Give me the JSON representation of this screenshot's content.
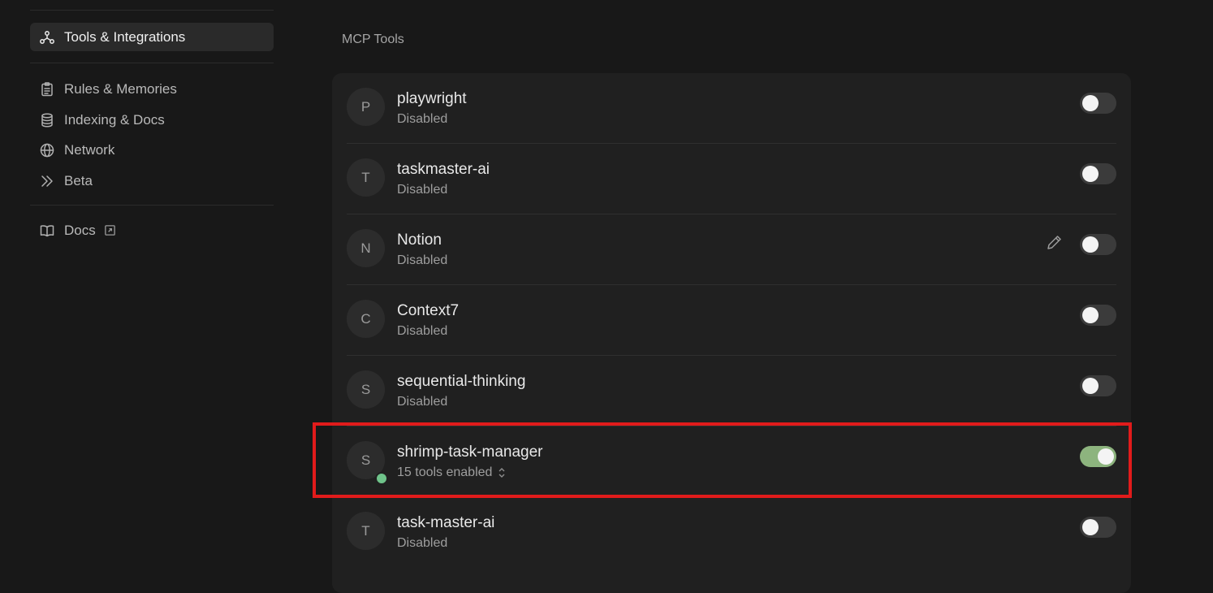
{
  "sidebar": {
    "items": [
      {
        "label": "Tools & Integrations",
        "icon": "tools-integrations-icon"
      },
      {
        "label": "Rules & Memories",
        "icon": "clipboard-icon"
      },
      {
        "label": "Indexing & Docs",
        "icon": "database-icon"
      },
      {
        "label": "Network",
        "icon": "globe-icon"
      },
      {
        "label": "Beta",
        "icon": "double-chevron-right-icon"
      },
      {
        "label": "Docs",
        "icon": "book-icon",
        "external": true
      }
    ],
    "active_item": "Tools & Integrations"
  },
  "main": {
    "section_title": "MCP Tools",
    "tools": [
      {
        "initial": "P",
        "name": "playwright",
        "status": "Disabled",
        "enabled": false
      },
      {
        "initial": "T",
        "name": "taskmaster-ai",
        "status": "Disabled",
        "enabled": false
      },
      {
        "initial": "N",
        "name": "Notion",
        "status": "Disabled",
        "enabled": false,
        "editable": true
      },
      {
        "initial": "C",
        "name": "Context7",
        "status": "Disabled",
        "enabled": false
      },
      {
        "initial": "S",
        "name": "sequential-thinking",
        "status": "Disabled",
        "enabled": false
      },
      {
        "initial": "S",
        "name": "shrimp-task-manager",
        "status": "15 tools enabled",
        "enabled": true,
        "connected": true
      },
      {
        "initial": "T",
        "name": "task-master-ai",
        "status": "Disabled",
        "enabled": false
      }
    ]
  },
  "colors": {
    "background": "#181818",
    "panel": "#202020",
    "toggle_on": "#8db47e",
    "toggle_off": "#3b3b3b",
    "status_dot": "#6fc38a",
    "highlight": "#e11b1b"
  }
}
